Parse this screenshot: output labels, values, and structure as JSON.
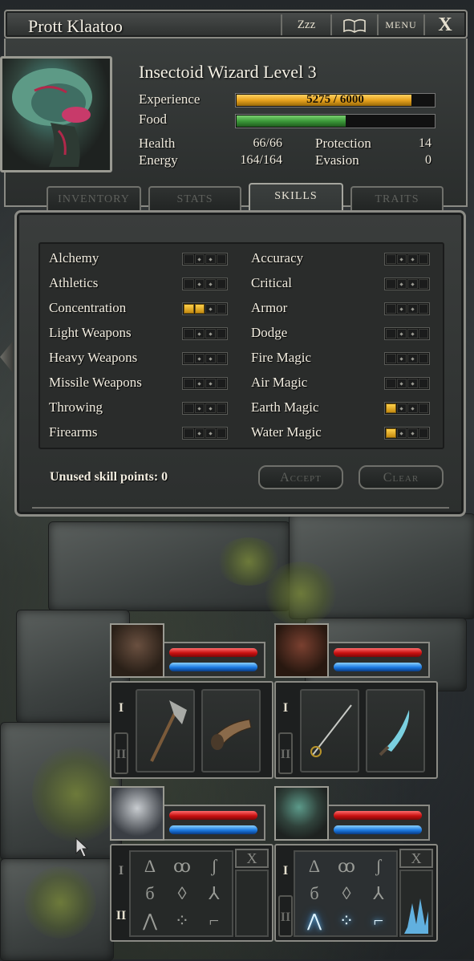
{
  "window": {
    "title": "Prott Klaatoo",
    "buttons": {
      "rest": "Zzz",
      "journal_icon": "book-icon",
      "menu": "MENU",
      "close": "X"
    }
  },
  "character": {
    "heading": "Insectoid Wizard Level 3",
    "experience_label": "Experience",
    "experience_value": "5275 / 6000",
    "experience_fraction": 0.879,
    "food_label": "Food",
    "food_fraction": 0.55,
    "health_label": "Health",
    "health_value": "66/66",
    "energy_label": "Energy",
    "energy_value": "164/164",
    "protection_label": "Protection",
    "protection_value": "14",
    "evasion_label": "Evasion",
    "evasion_value": "0"
  },
  "tabs": [
    {
      "label": "INVENTORY",
      "active": false
    },
    {
      "label": "STATS",
      "active": false
    },
    {
      "label": "SKILLS",
      "active": true
    },
    {
      "label": "TRAITS",
      "active": false
    }
  ],
  "skills_left": [
    {
      "name": "Alchemy",
      "level": 0
    },
    {
      "name": "Athletics",
      "level": 0
    },
    {
      "name": "Concentration",
      "level": 2
    },
    {
      "name": "Light Weapons",
      "level": 0
    },
    {
      "name": "Heavy Weapons",
      "level": 0
    },
    {
      "name": "Missile Weapons",
      "level": 0
    },
    {
      "name": "Throwing",
      "level": 0
    },
    {
      "name": "Firearms",
      "level": 0
    }
  ],
  "skills_right": [
    {
      "name": "Accuracy",
      "level": 0
    },
    {
      "name": "Critical",
      "level": 0
    },
    {
      "name": "Armor",
      "level": 0
    },
    {
      "name": "Dodge",
      "level": 0
    },
    {
      "name": "Fire Magic",
      "level": 0
    },
    {
      "name": "Air Magic",
      "level": 0
    },
    {
      "name": "Earth Magic",
      "level": 1
    },
    {
      "name": "Water Magic",
      "level": 1
    }
  ],
  "skill_footer": {
    "unused": "Unused skill points: 0",
    "accept": "Accept",
    "clear": "Clear"
  },
  "party": {
    "hand_tab_1": "I",
    "hand_tab_2": "II",
    "spell_close": "X",
    "members": [
      {
        "name": "minotaur",
        "slot1_icon": "axe-icon",
        "slot2_icon": "horn-icon"
      },
      {
        "name": "lizardman",
        "slot1_icon": "rapier-icon",
        "slot2_icon": "dagger-icon"
      },
      {
        "name": "human-mage",
        "runes": [
          "Δ",
          "ꝏ",
          "ʃ",
          "б",
          "◊",
          "⅄",
          "⋀",
          "⁘",
          "⌐"
        ]
      },
      {
        "name": "insectoid-wizard",
        "runes": [
          "Δ",
          "ꝏ",
          "ʃ",
          "б",
          "◊",
          "⅄",
          "⋀",
          "⁘",
          "⌐"
        ]
      }
    ]
  },
  "colors": {
    "experience_bar": "#e6a21e",
    "food_bar": "#3d9a3a",
    "skill_pip_on": "#f0b420",
    "health_bar": "#d81818",
    "energy_bar": "#1e7ce6"
  }
}
